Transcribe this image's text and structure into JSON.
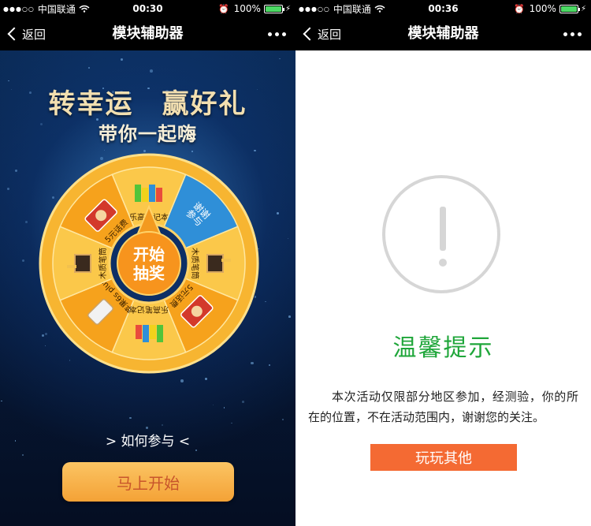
{
  "screens": [
    {
      "status": {
        "carrier": "中国联通",
        "signal": "●●●○○",
        "time": "00:30",
        "battery": "100%"
      },
      "nav": {
        "back_label": "返回",
        "title": "模块辅助器"
      },
      "headline": {
        "line1": "转幸运　赢好礼",
        "line2": "带你一起嗨"
      },
      "wheel": {
        "center_label_1": "开始",
        "center_label_2": "抽奖",
        "segments": [
          {
            "label": "乐高笔记本",
            "icon": "lego-icon"
          },
          {
            "label": "谢谢\n参与",
            "icon": "none"
          },
          {
            "label": "木质笔筒",
            "icon": "pen-holder-icon"
          },
          {
            "label": "5元话费",
            "icon": "phone-card-icon"
          },
          {
            "label": "乐高笔记本",
            "icon": "lego-icon"
          },
          {
            "label": "苹果6s plus",
            "icon": "phone-icon"
          },
          {
            "label": "木质笔筒",
            "icon": "pen-holder-icon"
          },
          {
            "label": "5元话费",
            "icon": "phone-card-icon"
          }
        ]
      },
      "how_to_join": "> 如何参与 <",
      "start_button": "马上开始"
    },
    {
      "status": {
        "carrier": "中国联通",
        "signal": "●●●○○",
        "time": "00:36",
        "battery": "100%"
      },
      "nav": {
        "back_label": "返回",
        "title": "模块辅助器"
      },
      "tip": {
        "title": "温馨提示",
        "body": "本次活动仅限部分地区参加，经测验，你的所在的位置，不在活动范围内，谢谢您的关注。"
      },
      "play_button": "玩玩其他"
    }
  ],
  "colors": {
    "wheel_orange": "#f6a21c",
    "wheel_yellow": "#fbc84a",
    "wheel_blue": "#2f8fd8",
    "tip_green": "#1fa63a",
    "play_orange": "#f46a33",
    "start_gold": "#fbc463"
  }
}
